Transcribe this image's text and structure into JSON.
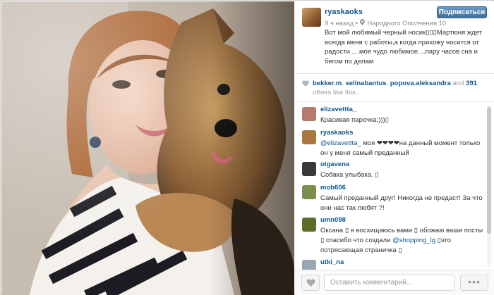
{
  "post": {
    "username": "ryaskaoks",
    "follow_label": "Подписаться",
    "time": "9 ч назад",
    "location": "Народного Ополчения 10",
    "caption": "Вот мой любимый черный носик▯▯▯Мартюня ждет всегда меня с работы,а когда прихожу носится от радости ....мое чудо любимое....пару часов сна и бегом по делам"
  },
  "likes": {
    "users": [
      "bekker.m",
      "selinabantus",
      "popova.aleksandra"
    ],
    "sep1": ", ",
    "sep2": ", ",
    "and_text": " and ",
    "count": "391",
    "others_text": " others like this."
  },
  "comments": [
    {
      "user": "elizavettta_",
      "text": "Красивая парочка;)))▯",
      "avatar_color": "#b67b6a"
    },
    {
      "user": "ryaskaoks",
      "mention": "@elizavettta_",
      "text": " моя ❤❤❤❤на данный момент только он у меня самый преданный",
      "avatar_color": "#a8763f"
    },
    {
      "user": "olgavena",
      "text": "Собака улыбака. ▯",
      "avatar_color": "#3a3a3a"
    },
    {
      "user": "mob606",
      "text": "Самый преданный друг! Никогда не предаст! За что они нас так любят ?!",
      "avatar_color": "#7b8f4e"
    },
    {
      "user": "umn098",
      "text_a": "Оксана ▯ я восхищаюсь вами ▯ обожаю ваши посты ▯ спасибо что создали ",
      "mention": "@shopping_lg",
      "text_b": " ▯это потрясающая страничка ▯",
      "avatar_color": "#5a6e2a"
    },
    {
      "user": "utki_na",
      "text": "",
      "avatar_color": "#9aa6b1"
    }
  ],
  "footer": {
    "comment_placeholder": "Оставить комментарий...",
    "more_label": "•••"
  },
  "colors": {
    "link": "#125688",
    "follow_bg": "#3f729b"
  },
  "icons": [
    "location-pin-icon",
    "heart-icon",
    "more-options-icon"
  ]
}
